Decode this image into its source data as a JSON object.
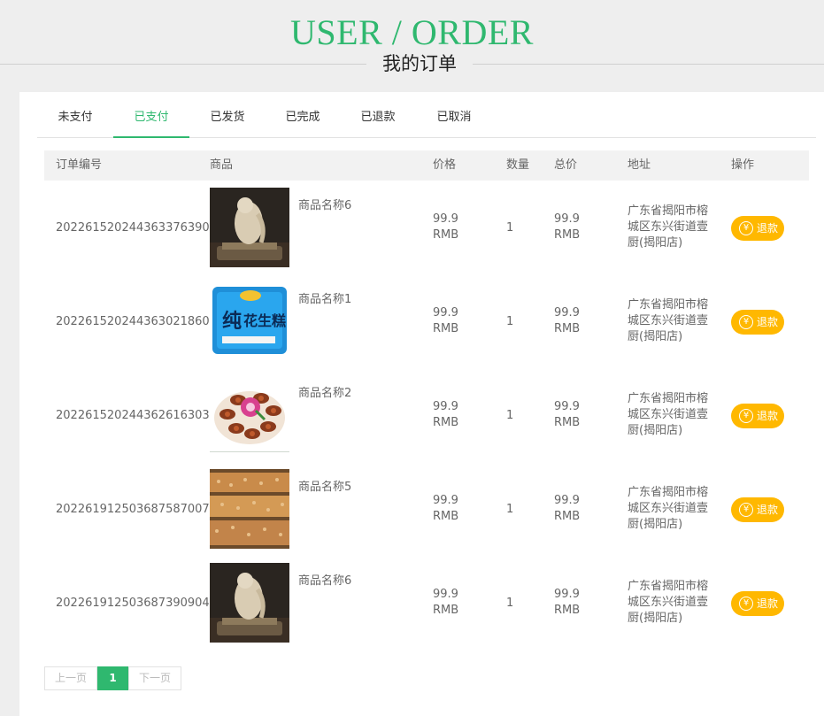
{
  "header": {
    "title": "USER / ORDER",
    "subtitle": "我的订单"
  },
  "tabs": [
    {
      "label": "未支付",
      "active": false
    },
    {
      "label": "已支付",
      "active": true
    },
    {
      "label": "已发货",
      "active": false
    },
    {
      "label": "已完成",
      "active": false
    },
    {
      "label": "已退款",
      "active": false
    },
    {
      "label": "已取消",
      "active": false
    }
  ],
  "table": {
    "headers": [
      "订单编号",
      "商品",
      "价格",
      "数量",
      "总价",
      "地址",
      "操作"
    ],
    "rows": [
      {
        "order_no": "20226152024436337639​0",
        "product": "商品名称6",
        "price_num": "99.9",
        "price_unit": "RMB",
        "qty": "1",
        "total_num": "99.9",
        "total_unit": "RMB",
        "address": "广东省揭阳市榕城区东兴街道壹厨(揭阳店)",
        "action": "退款",
        "image": "statue-icon"
      },
      {
        "order_no": "20226152024436302186​0",
        "product": "商品名称1",
        "price_num": "99.9",
        "price_unit": "RMB",
        "qty": "1",
        "total_num": "99.9",
        "total_unit": "RMB",
        "address": "广东省揭阳市榕城区东兴街道壹厨(揭阳店)",
        "action": "退款",
        "image": "candy-box-icon"
      },
      {
        "order_no": "20226152024436261630​3",
        "product": "商品名称2",
        "price_num": "99.9",
        "price_unit": "RMB",
        "qty": "1",
        "total_num": "99.9",
        "total_unit": "RMB",
        "address": "广东省揭阳市榕城区东兴街道壹厨(揭阳店)",
        "action": "退款",
        "image": "food-platter-icon"
      },
      {
        "order_no": "20226191250368758700​7",
        "product": "商品名称5",
        "price_num": "99.9",
        "price_unit": "RMB",
        "qty": "1",
        "total_num": "99.9",
        "total_unit": "RMB",
        "address": "广东省揭阳市榕城区东兴街道壹厨(揭阳店)",
        "action": "退款",
        "image": "peanut-brittle-icon"
      },
      {
        "order_no": "20226191250368739090​4",
        "product": "商品名称6",
        "price_num": "99.9",
        "price_unit": "RMB",
        "qty": "1",
        "total_num": "99.9",
        "total_unit": "RMB",
        "address": "广东省揭阳市榕城区东兴街道壹厨(揭阳店)",
        "action": "退款",
        "image": "statue-icon"
      }
    ]
  },
  "pager": {
    "prev": "上一页",
    "current": "1",
    "next": "下一页"
  },
  "colors": {
    "accent": "#2fb86f",
    "refund": "#ffb800"
  }
}
